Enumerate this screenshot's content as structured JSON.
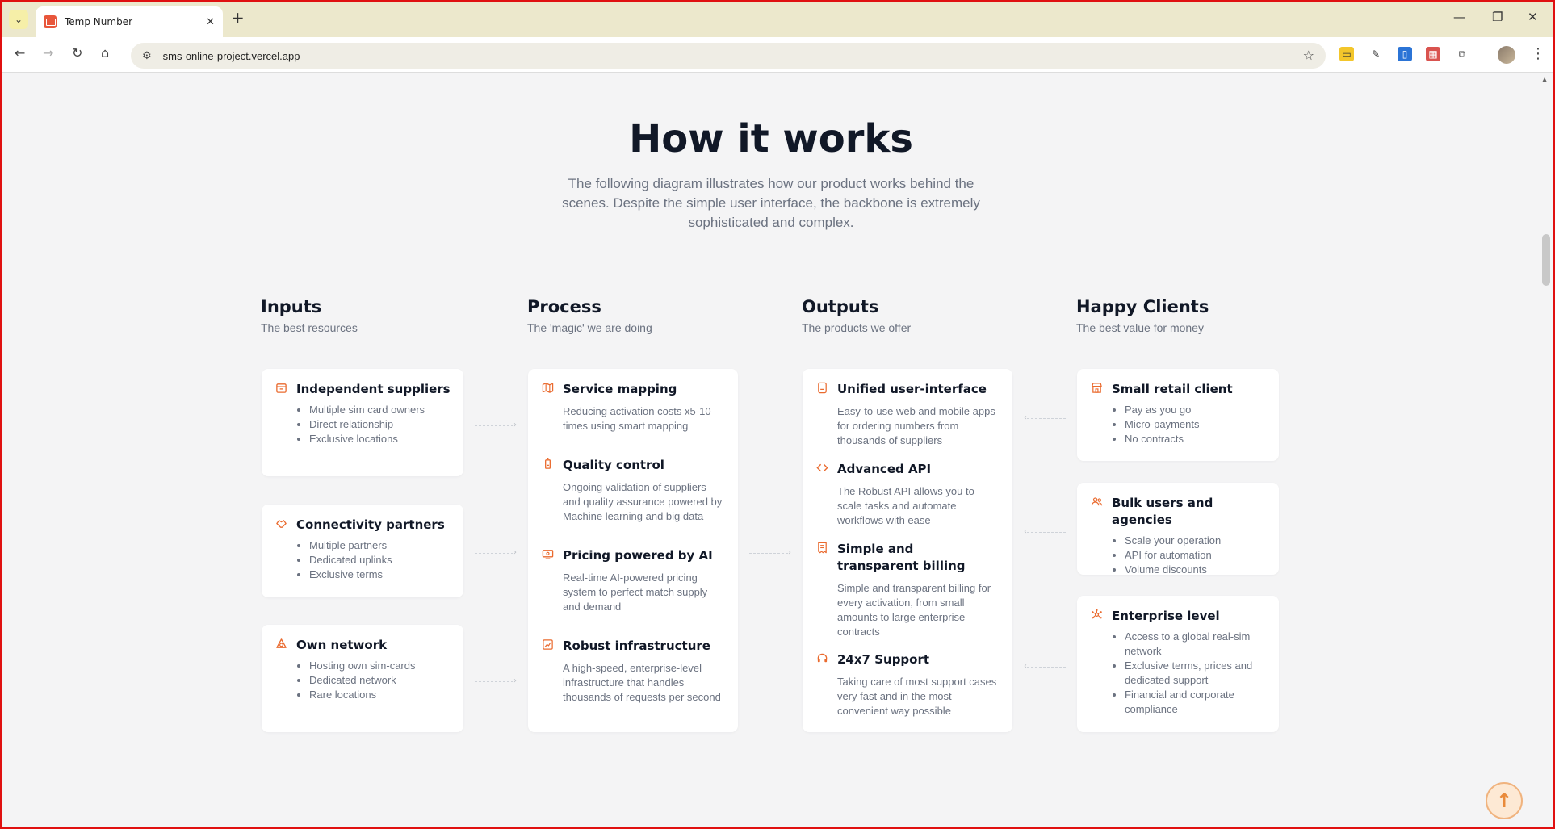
{
  "browser": {
    "tab_title": "Temp Number",
    "url": "sms-online-project.vercel.app",
    "new_tab_label": "+",
    "tab_close_label": "✕"
  },
  "section": {
    "title": "How it works",
    "description": "The following diagram illustrates how our product works behind the scenes. Despite the simple user interface, the backbone is extremely sophisticated and complex."
  },
  "columns": {
    "inputs": {
      "title": "Inputs",
      "subtitle": "The best resources"
    },
    "process": {
      "title": "Process",
      "subtitle": "The 'magic' we are doing"
    },
    "outputs": {
      "title": "Outputs",
      "subtitle": "The products we offer"
    },
    "clients": {
      "title": "Happy Clients",
      "subtitle": "The best value for money"
    }
  },
  "inputs": [
    {
      "icon": "box-icon",
      "title": "Independent suppliers",
      "bullets": [
        "Multiple sim card owners",
        "Direct relationship",
        "Exclusive locations"
      ]
    },
    {
      "icon": "handshake-icon",
      "title": "Connectivity partners",
      "bullets": [
        "Multiple partners",
        "Dedicated uplinks",
        "Exclusive terms"
      ]
    },
    {
      "icon": "network-icon",
      "title": "Own network",
      "bullets": [
        "Hosting own sim-cards",
        "Dedicated network",
        "Rare locations"
      ]
    }
  ],
  "process": [
    {
      "icon": "map-icon",
      "title": "Service mapping",
      "desc": "Reducing activation costs x5-10 times using smart mapping"
    },
    {
      "icon": "battery-icon",
      "title": "Quality control",
      "desc": "Ongoing validation of suppliers and quality assurance powered by Machine learning and big data"
    },
    {
      "icon": "monitor-icon",
      "title": "Pricing powered by AI",
      "desc": "Real-time AI-powered pricing system to perfect match supply and demand"
    },
    {
      "icon": "chart-icon",
      "title": "Robust infrastructure",
      "desc": "A high-speed, enterprise-level infrastructure that handles thousands of requests per second"
    }
  ],
  "outputs": [
    {
      "icon": "app-icon",
      "title": "Unified user-interface",
      "desc": "Easy-to-use web and mobile apps for ordering numbers from thousands of suppliers"
    },
    {
      "icon": "code-icon",
      "title": "Advanced API",
      "desc": "The Robust API allows you to scale tasks and automate workflows with ease"
    },
    {
      "icon": "receipt-icon",
      "title": "Simple and transparent billing",
      "desc": "Simple and transparent billing for every activation, from small amounts to large enterprise contracts"
    },
    {
      "icon": "headset-icon",
      "title": "24x7 Support",
      "desc": "Taking care of most support cases very fast and in the most convenient way possible"
    }
  ],
  "clients": [
    {
      "icon": "store-icon",
      "title": "Small retail client",
      "bullets": [
        "Pay as you go",
        "Micro-payments",
        "No contracts"
      ]
    },
    {
      "icon": "users-icon",
      "title": "Bulk users and agencies",
      "bullets": [
        "Scale your operation",
        "API for automation",
        "Volume discounts"
      ]
    },
    {
      "icon": "hub-icon",
      "title": "Enterprise level",
      "bullets": [
        "Access to a global real-sim network",
        "Exclusive terms, prices and dedicated support",
        "Financial and corporate compliance"
      ]
    }
  ],
  "colors": {
    "accent": "#ea6a2e",
    "page_bg": "#f4f4f5",
    "card_bg": "#ffffff",
    "heading": "#111827",
    "muted": "#6b7280"
  },
  "scroll_top_icon": "arrow-up-icon"
}
